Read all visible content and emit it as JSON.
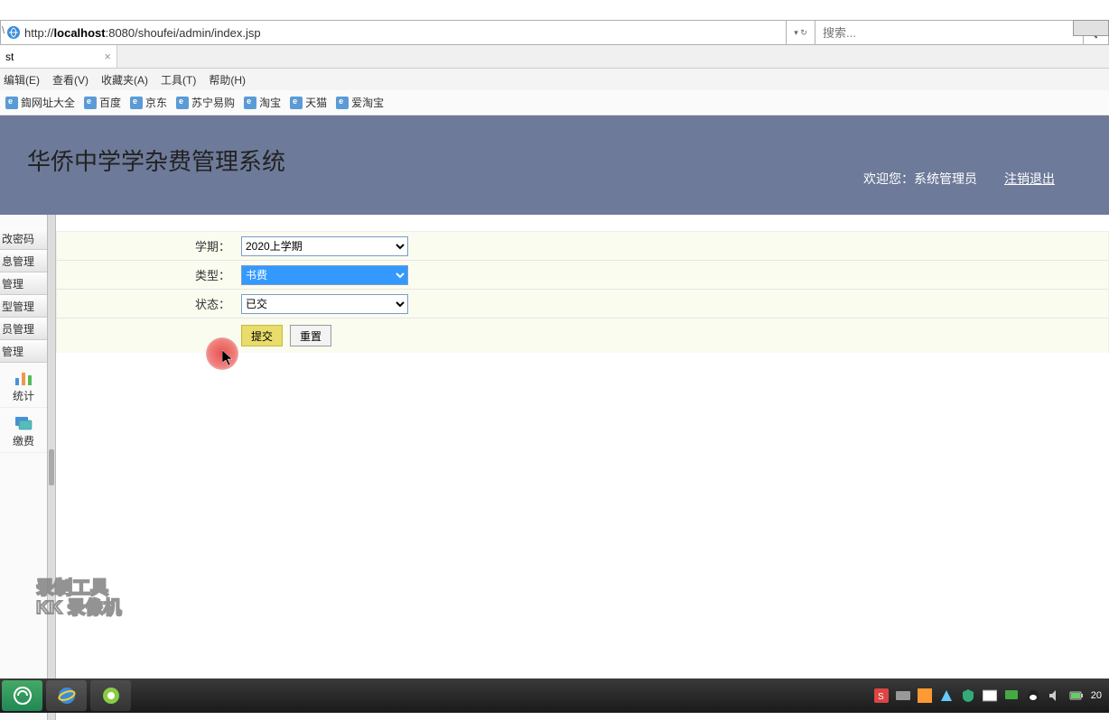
{
  "browser": {
    "url_prefix": "http://",
    "url_host": "localhost",
    "url_rest": ":8080/shoufei/admin/index.jsp",
    "search_placeholder": "搜索...",
    "tab_title": "st"
  },
  "menus": [
    "编辑(E)",
    "查看(V)",
    "收藏夹(A)",
    "工具(T)",
    "帮助(H)"
  ],
  "bookmarks": [
    "鍧网址大全",
    "百度",
    "京东",
    "苏宁易购",
    "淘宝",
    "天猫",
    "爱淘宝"
  ],
  "header": {
    "title": "华侨中学学杂费管理系统",
    "welcome": "欢迎您：系统管理员",
    "logout": "注销退出"
  },
  "sidebar": {
    "tab_hint": "\\",
    "items": [
      "改密码",
      "息管理",
      "管理",
      "型管理",
      "员管理",
      "管理"
    ],
    "sub_items": [
      "统计",
      "缴费"
    ]
  },
  "form": {
    "semester_label": "学期：",
    "semester_value": "2020上学期",
    "type_label": "类型：",
    "type_value": "书费",
    "status_label": "状态：",
    "status_value": "已交",
    "submit": "提交",
    "reset": "重置"
  },
  "watermark": {
    "line1": "录制工具",
    "line2": "KK 录像机"
  },
  "taskbar": {
    "time": "20"
  }
}
